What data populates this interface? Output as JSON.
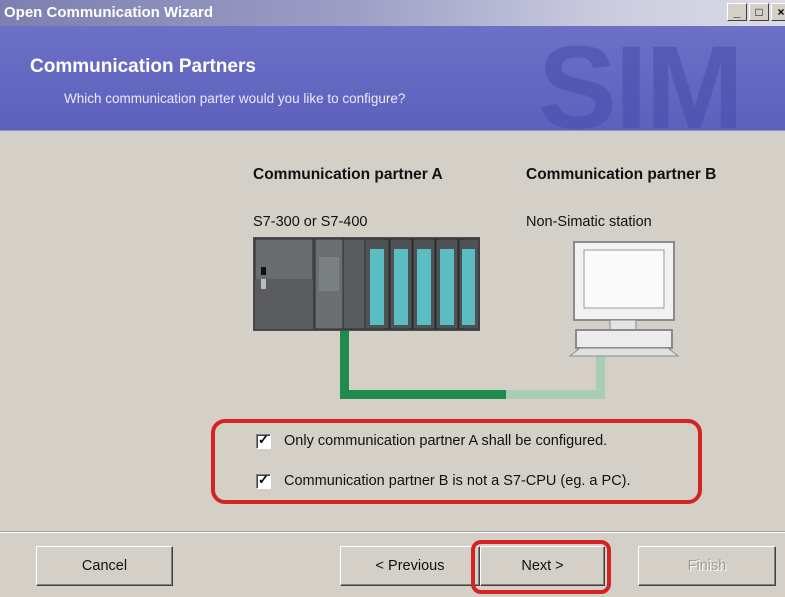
{
  "window": {
    "title": "Open Communication Wizard",
    "controls": [
      "minimize-icon",
      "maximize-icon",
      "close-icon"
    ]
  },
  "header": {
    "title": "Communication Partners",
    "subtitle": "Which communication parter would you like to configure?",
    "watermark": "SIM"
  },
  "partners": {
    "a": {
      "heading": "Communication partner A",
      "type": "S7-300 or S7-400"
    },
    "b": {
      "heading": "Communication partner B",
      "type": "Non-Simatic station"
    }
  },
  "options": [
    {
      "label": "Only communication partner A shall be configured.",
      "checked": true
    },
    {
      "label": "Communication partner B is not a S7-CPU (eg. a PC).",
      "checked": true
    }
  ],
  "buttons": {
    "cancel": "Cancel",
    "previous": "< Previous",
    "next": "Next >",
    "finish": "Finish"
  },
  "colors": {
    "highlight": "#d42323",
    "cable": "#1f8c4e",
    "header": "#5c61bd"
  }
}
